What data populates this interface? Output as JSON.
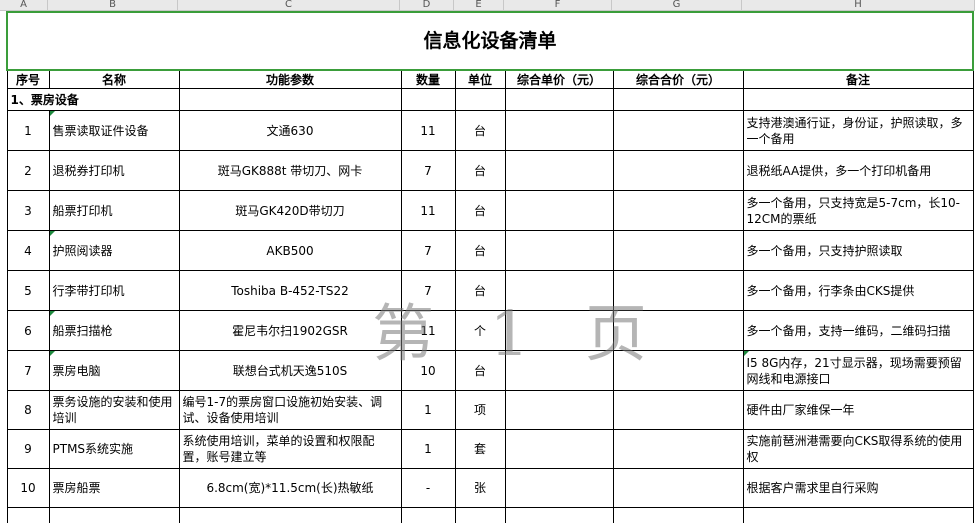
{
  "columns": [
    "A",
    "B",
    "C",
    "D",
    "E",
    "F",
    "G",
    "H"
  ],
  "title": "信息化设备清单",
  "headers": [
    "序号",
    "名称",
    "功能参数",
    "数量",
    "单位",
    "综合单价（元）",
    "综合合价（元）",
    "备注"
  ],
  "section1": "1、票房设备",
  "rows": [
    {
      "no": "1",
      "name": "售票读取证件设备",
      "spec": "文通630",
      "qty": "11",
      "unit": "台",
      "price": "",
      "total": "",
      "note": "支持港澳通行证，身份证，护照读取，多一个备用"
    },
    {
      "no": "2",
      "name": "退税券打印机",
      "spec": "斑马GK888t 带切刀、网卡",
      "qty": "7",
      "unit": "台",
      "price": "",
      "total": "",
      "note": "退税纸AA提供，多一个打印机备用"
    },
    {
      "no": "3",
      "name": "船票打印机",
      "spec": "斑马GK420D带切刀",
      "qty": "11",
      "unit": "台",
      "price": "",
      "total": "",
      "note": "多一个备用，只支持宽是5-7cm，长10-12CM的票纸"
    },
    {
      "no": "4",
      "name": "护照阅读器",
      "spec": "AKB500",
      "qty": "7",
      "unit": "台",
      "price": "",
      "total": "",
      "note": "多一个备用，只支持护照读取"
    },
    {
      "no": "5",
      "name": "行李带打印机",
      "spec": "Toshiba B-452-TS22",
      "qty": "7",
      "unit": "台",
      "price": "",
      "total": "",
      "note": "多一个备用，行李条由CKS提供"
    },
    {
      "no": "6",
      "name": "船票扫描枪",
      "spec": "霍尼韦尔扫1902GSR",
      "qty": "11",
      "unit": "个",
      "price": "",
      "total": "",
      "note": "多一个备用，支持一维码，二维码扫描"
    },
    {
      "no": "7",
      "name": "票房电脑",
      "spec": "联想台式机天逸510S",
      "qty": "10",
      "unit": "台",
      "price": "",
      "total": "",
      "note": "I5 8G内存，21寸显示器，现场需要预留网线和电源接口"
    },
    {
      "no": "8",
      "name": "票务设施的安装和使用培训",
      "spec": "编号1-7的票房窗口设施初始安装、调试、设备使用培训",
      "qty": "1",
      "unit": "项",
      "price": "",
      "total": "",
      "note": "硬件由厂家维保一年"
    },
    {
      "no": "9",
      "name": "PTMS系统实施",
      "spec": "系统使用培训，菜单的设置和权限配置，账号建立等",
      "qty": "1",
      "unit": "套",
      "price": "",
      "total": "",
      "note": "实施前琶洲港需要向CKS取得系统的使用权"
    },
    {
      "no": "10",
      "name": "票房船票",
      "spec": "6.8cm(宽)*11.5cm(长)热敏纸",
      "qty": "-",
      "unit": "张",
      "price": "",
      "total": "",
      "note": "根据客户需求里自行采购"
    }
  ],
  "watermark": "第 1 页"
}
